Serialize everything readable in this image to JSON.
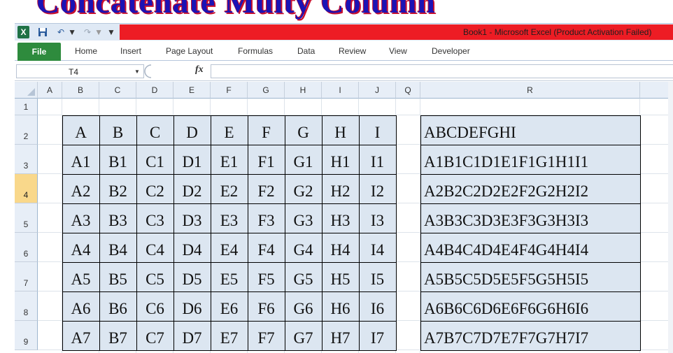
{
  "banner": {
    "title": "Concatenate Multy Column"
  },
  "window": {
    "title": "Book1  -  Microsoft Excel (Product Activation Failed)"
  },
  "icons": {
    "app": "excel-icon",
    "save": "save-icon",
    "undo": "undo-icon",
    "redo": "redo-icon",
    "customize": "customize-qat-icon",
    "function": "fx-icon"
  },
  "glyphs": {
    "app": "X",
    "save": "🖫",
    "undo": "↶",
    "redo": "↷",
    "dropdown": "▼",
    "customize": "⁼",
    "fx": "fx"
  },
  "ribbon": {
    "file": "File",
    "tabs": [
      "Home",
      "Insert",
      "Page Layout",
      "Formulas",
      "Data",
      "Review",
      "View",
      "Developer"
    ]
  },
  "formula_bar": {
    "name_box": "T4",
    "formula": ""
  },
  "grid": {
    "columns": [
      "A",
      "B",
      "C",
      "D",
      "E",
      "F",
      "G",
      "H",
      "I",
      "J",
      "Q",
      "R"
    ],
    "rows": [
      "1",
      "2",
      "3",
      "4",
      "5",
      "6",
      "7",
      "8",
      "9"
    ],
    "selected_row": "4",
    "table_rows": [
      [
        "A",
        "B",
        "C",
        "D",
        "E",
        "F",
        "G",
        "H",
        "I"
      ],
      [
        "A1",
        "B1",
        "C1",
        "D1",
        "E1",
        "F1",
        "G1",
        "H1",
        "I1"
      ],
      [
        "A2",
        "B2",
        "C2",
        "D2",
        "E2",
        "F2",
        "G2",
        "H2",
        "I2"
      ],
      [
        "A3",
        "B3",
        "C3",
        "D3",
        "E3",
        "F3",
        "G3",
        "H3",
        "I3"
      ],
      [
        "A4",
        "B4",
        "C4",
        "D4",
        "E4",
        "F4",
        "G4",
        "H4",
        "I4"
      ],
      [
        "A5",
        "B5",
        "C5",
        "D5",
        "E5",
        "F5",
        "G5",
        "H5",
        "I5"
      ],
      [
        "A6",
        "B6",
        "C6",
        "D6",
        "E6",
        "F6",
        "G6",
        "H6",
        "I6"
      ],
      [
        "A7",
        "B7",
        "C7",
        "D7",
        "E7",
        "F7",
        "G7",
        "H7",
        "I7"
      ]
    ],
    "results": [
      "ABCDEFGHI",
      "A1B1C1D1E1F1G1H1I1",
      "A2B2C2D2E2F2G2H2I2",
      "A3B3C3D3E3F3G3H3I3",
      "A4B4C4D4E4F4G4H4I4",
      "A5B5C5D5E5F5G5H5I5",
      "A6B6C6D6E6F6G6H6I6",
      "A7B7C7D7E7F7G7H7I7"
    ]
  },
  "colors": {
    "title_bar": "#ed1c24",
    "file_tab": "#2e8b3d",
    "cell_fill": "#dce6f1",
    "banner_text": "#1b13b5",
    "selected_row": "#f9d88b"
  }
}
